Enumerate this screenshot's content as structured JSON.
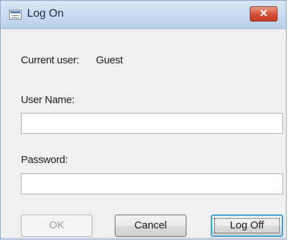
{
  "dialog": {
    "title": "Log On",
    "title_icon": "window-icon",
    "close_glyph": "✕"
  },
  "current_user": {
    "label": "Current user:",
    "value": "Guest"
  },
  "username": {
    "label": "User Name:",
    "value": "",
    "placeholder": ""
  },
  "password": {
    "label": "Password:",
    "value": "",
    "placeholder": ""
  },
  "buttons": {
    "ok": "OK",
    "cancel": "Cancel",
    "logoff": "Log Off"
  },
  "colors": {
    "titlebar": "#c5d9ef",
    "close_button": "#d5553b",
    "default_button_border": "#3c7fb1"
  }
}
